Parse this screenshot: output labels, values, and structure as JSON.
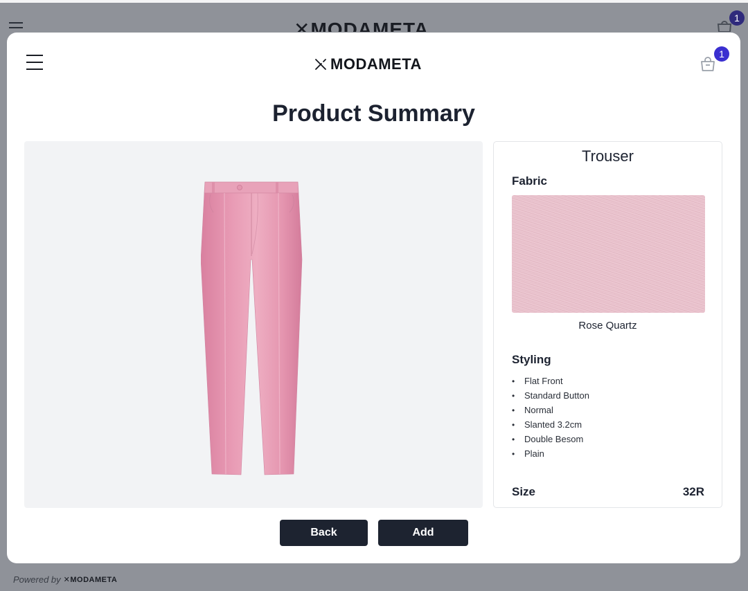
{
  "background": {
    "brand": "MODAMETA",
    "cart_count": "1",
    "footer_prefix": "Powered by",
    "footer_brand": "MODAMETA"
  },
  "header": {
    "brand": "MODAMETA",
    "cart_count": "1",
    "icons": [
      "menu-icon",
      "brand-logo-mark",
      "shopping-bag-icon"
    ]
  },
  "page": {
    "title": "Product Summary"
  },
  "product": {
    "name": "Trouser",
    "fabric_heading": "Fabric",
    "fabric_name": "Rose Quartz",
    "fabric_color": "#e9c1cc",
    "trouser_color": "#e497b0",
    "styling_heading": "Styling",
    "styling": [
      "Flat Front",
      "Standard Button",
      "Normal",
      "Slanted 3.2cm",
      "Double Besom",
      "Plain"
    ],
    "size_label": "Size",
    "size_value": "32R"
  },
  "actions": {
    "back_label": "Back",
    "add_label": "Add"
  },
  "colors": {
    "button_bg": "#1d2330",
    "badge_bg": "#3a2fd0",
    "overlay": "#8f9299"
  }
}
